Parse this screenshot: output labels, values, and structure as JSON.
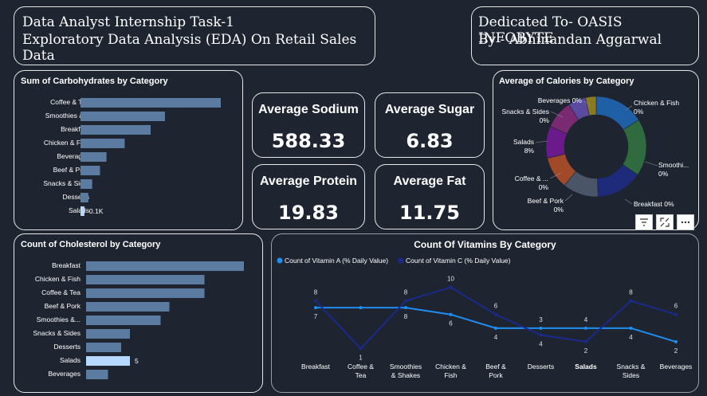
{
  "header": {
    "line1": "Data Analyst Internship Task-1",
    "line2": "Exploratory Data Analysis (EDA) On Retail Sales Data",
    "dedicated1": "Dedicated To- OASIS INFOBYTE",
    "dedicated2": "By - Abhinandan Aggarwal"
  },
  "kpis": {
    "sodium_label": "Average Sodium",
    "sodium_value": "588.33",
    "sugar_label": "Average Sugar",
    "sugar_value": "6.83",
    "protein_label": "Average Protein",
    "protein_value": "19.83",
    "fat_label": "Average Fat",
    "fat_value": "11.75"
  },
  "colors": {
    "bar": "#5c7ba0",
    "bar_highlight": "#b8d9ff",
    "vitA": "#1f8ef1",
    "vitC": "#1a2a8c"
  },
  "icons": {
    "filter": "filter-icon",
    "focus": "focus-mode-icon",
    "more": "more-options-icon"
  },
  "chart_data": [
    {
      "type": "bar",
      "orientation": "horizontal",
      "title": "Sum of Carbohydrates by Category",
      "categories": [
        "Coffee & Tea",
        "Smoothies &...",
        "Breakfast",
        "Chicken & Fish",
        "Beverages",
        "Beef & Pork",
        "Snacks & Sid...",
        "Desserts",
        "Salads"
      ],
      "values": [
        1.08,
        0.65,
        0.54,
        0.34,
        0.2,
        0.15,
        0.09,
        0.06,
        0.03
      ],
      "highlight_index": 8,
      "highlight_label": "0.1K"
    },
    {
      "type": "bar",
      "orientation": "horizontal",
      "title": "Count of Cholesterol by Category",
      "categories": [
        "Breakfast",
        "Chicken & Fish",
        "Coffee & Tea",
        "Beef & Pork",
        "Smoothies &...",
        "Snacks & Sides",
        "Desserts",
        "Salads",
        "Beverages"
      ],
      "values": [
        18,
        13.5,
        13.5,
        9.5,
        8.5,
        5,
        4,
        5,
        2.5
      ],
      "highlight_index": 7,
      "highlight_label": "5"
    },
    {
      "type": "pie",
      "title": "Average of Calories by Category",
      "labels": [
        {
          "line1": "Chicken & Fish",
          "line2": "0%"
        },
        {
          "line1": "Smoothi...",
          "line2": "0%"
        },
        {
          "line1": "Breakfast 0%",
          "line2": ""
        },
        {
          "line1": "Beef & Pork",
          "line2": "0%"
        },
        {
          "line1": "Coffee & ...",
          "line2": "0%"
        },
        {
          "line1": "Salads",
          "line2": "8%"
        },
        {
          "line1": "Snacks & Sides",
          "line2": "0%"
        },
        {
          "line1": "Beverages 0%",
          "line2": ""
        }
      ],
      "slices": [
        {
          "value": 14,
          "color": "#1f5fa6"
        },
        {
          "value": 16,
          "color": "#2f6b3f"
        },
        {
          "value": 13,
          "color": "#1e2a7a"
        },
        {
          "value": 10,
          "color": "#4a5568"
        },
        {
          "value": 9,
          "color": "#a04a2a"
        },
        {
          "value": 9,
          "color": "#6a1a8a"
        },
        {
          "value": 8,
          "color": "#7a2a70"
        },
        {
          "value": 5,
          "color": "#5a4aa0"
        },
        {
          "value": 3,
          "color": "#8a7a20"
        }
      ]
    },
    {
      "type": "line",
      "title": "Count Of Vitamins By Category",
      "categories": [
        "Breakfast",
        "Coffee &\nTea",
        "Smoothies\n& Shakes",
        "Chicken &\nFish",
        "Beef &\nPork",
        "Desserts",
        "Salads",
        "Snacks &\nSides",
        "Beverages"
      ],
      "ylim": [
        0,
        11
      ],
      "series": [
        {
          "name": "Count of Vitamin A (% Daily Value)",
          "values": [
            7,
            7,
            7,
            6,
            4,
            4,
            4,
            4,
            2
          ],
          "labels": [
            "7",
            "",
            "8",
            "6",
            "4",
            "3",
            "4",
            "4",
            "2"
          ]
        },
        {
          "name": "Count of Vitamin C (% Daily Value)",
          "values": [
            8,
            1,
            8,
            10,
            6,
            3,
            2,
            8,
            6
          ],
          "labels": [
            "8",
            "1",
            "8",
            "10",
            "6",
            "4",
            "2",
            "8",
            "6"
          ]
        }
      ]
    }
  ]
}
